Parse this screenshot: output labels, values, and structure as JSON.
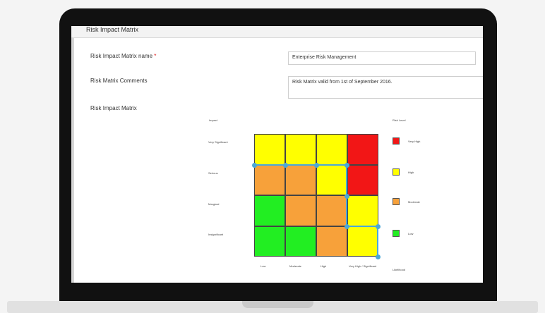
{
  "section": {
    "title": "Risk Impact Matrix"
  },
  "form": {
    "name_label": "Risk Impact Matrix name",
    "name_required": "*",
    "name_value": "Enterprise Risk Management",
    "comments_label": "Risk Matrix Comments",
    "comments_value": "Risk Matrix valid from 1st of September 2016.",
    "matrix_label": "Risk Impact Matrix"
  },
  "matrix": {
    "impact_axis_label": "Impact",
    "likelihood_axis_label": "Likelihood",
    "impact_levels": [
      "Very Significant",
      "Serious",
      "Marginal",
      "Insignificant"
    ],
    "likelihood_levels": [
      "Low",
      "Moderate",
      "High",
      "Very High / Significant"
    ],
    "cells": [
      [
        "yellow",
        "yellow",
        "yellow",
        "red"
      ],
      [
        "orange",
        "orange",
        "yellow",
        "red"
      ],
      [
        "green",
        "orange",
        "orange",
        "yellow"
      ],
      [
        "green",
        "green",
        "orange",
        "yellow"
      ]
    ],
    "colors": {
      "green": "#22ee22",
      "yellow": "#ffff00",
      "orange": "#f7a13a",
      "red": "#f21616",
      "handle": "#4aa8d8"
    }
  },
  "legend": {
    "title": "Risk Level",
    "items": [
      {
        "color": "red",
        "label": "Very High"
      },
      {
        "color": "yellow",
        "label": "High"
      },
      {
        "color": "orange",
        "label": "Moderate"
      },
      {
        "color": "green",
        "label": "Low"
      }
    ]
  }
}
